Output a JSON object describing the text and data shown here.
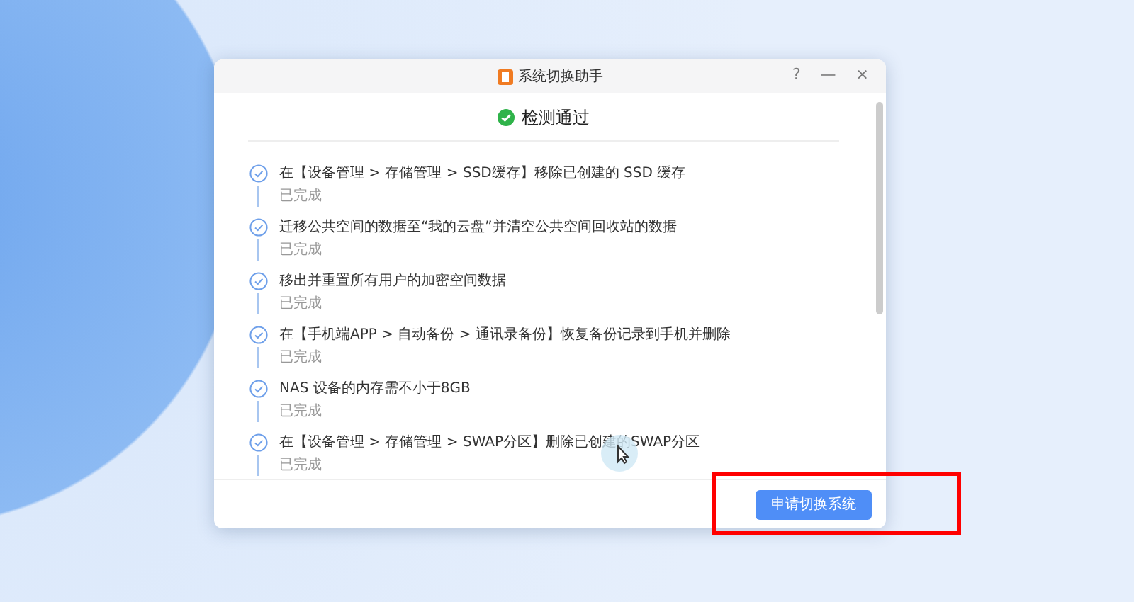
{
  "window": {
    "title": "系统切换助手",
    "help": "?",
    "minimize": "—",
    "close": "×"
  },
  "header": {
    "title": "检测通过",
    "passed": true
  },
  "steps": [
    {
      "text": "在【设备管理 > 存储管理 > SSD缓存】移除已创建的 SSD 缓存",
      "status": "已完成",
      "done": true
    },
    {
      "text": "迁移公共空间的数据至“我的云盘”并清空公共空间回收站的数据",
      "status": "已完成",
      "done": true
    },
    {
      "text": "移出并重置所有用户的加密空间数据",
      "status": "已完成",
      "done": true
    },
    {
      "text": "在【手机端APP > 自动备份 > 通讯录备份】恢复备份记录到手机并删除",
      "status": "已完成",
      "done": true
    },
    {
      "text": "NAS 设备的内存需不小于8GB",
      "status": "已完成",
      "done": true
    },
    {
      "text": "在【设备管理 > 存储管理 > SWAP分区】删除已创建的SWAP分区",
      "status": "已完成",
      "done": true
    }
  ],
  "footer": {
    "button": "申请切换系统",
    "highlighted": true
  }
}
